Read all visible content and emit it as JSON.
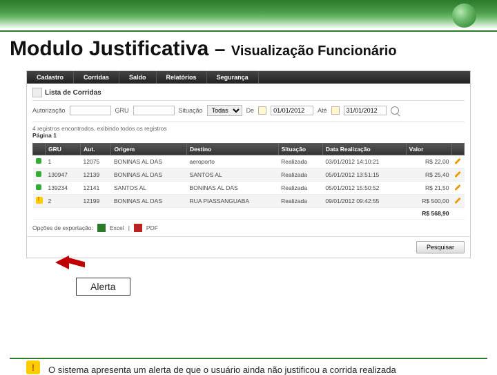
{
  "slide": {
    "title_main": "Modulo Justificativa",
    "title_sep": "–",
    "title_sub": "Visualização Funcionário",
    "callout": "Alerta",
    "footnote": "O sistema apresenta um alerta de que o usuário ainda não justificou a corrida realizada"
  },
  "tabs": {
    "cadastro": "Cadastro",
    "corridas": "Corridas",
    "saldo": "Saldo",
    "relatorios": "Relatórios",
    "seguranca": "Segurança"
  },
  "list_header": "Lista de Corridas",
  "filters": {
    "auth_label": "Autorização",
    "auth_value": "",
    "gru_label": "GRU",
    "gru_value": "",
    "sit_label": "Situação",
    "sit_value": "Todas",
    "date_from_label": "De",
    "date_from_value": "01/01/2012",
    "date_to_label": "Até",
    "date_to_value": "31/01/2012"
  },
  "results_text": "4 registros encontrados, exibindo todos os registros",
  "page_text": "Página 1",
  "columns": {
    "gru": "GRU",
    "aut": "Aut.",
    "origem": "Origem",
    "destino": "Destino",
    "situacao": "Situação",
    "data": "Data Realização",
    "valor": "Valor"
  },
  "rows": [
    {
      "gru": "1",
      "aut": "12075",
      "origem": "BONINAS AL DAS",
      "destino": "aeroporto",
      "situacao": "Realizada",
      "data": "03/01/2012 14:10:21",
      "valor": "R$ 22,00"
    },
    {
      "gru": "130947",
      "aut": "12139",
      "origem": "BONINAS AL DAS",
      "destino": "SANTOS AL",
      "situacao": "Realizada",
      "data": "05/01/2012 13:51:15",
      "valor": "R$ 25,40"
    },
    {
      "gru": "139234",
      "aut": "12141",
      "origem": "SANTOS AL",
      "destino": "BONINAS AL DAS",
      "situacao": "Realizada",
      "data": "05/01/2012 15:50:52",
      "valor": "R$ 21,50"
    },
    {
      "gru": "2",
      "aut": "12199",
      "origem": "BONINAS AL DAS",
      "destino": "RUA PIASSANGUABA",
      "situacao": "Realizada",
      "data": "09/01/2012 09:42:55",
      "valor": "R$ 500,00"
    }
  ],
  "total_value": "R$ 568,90",
  "export": {
    "label": "Opções de exportação:",
    "excel": "Excel",
    "pdf": "PDF"
  },
  "search_btn": "Pesquisar"
}
